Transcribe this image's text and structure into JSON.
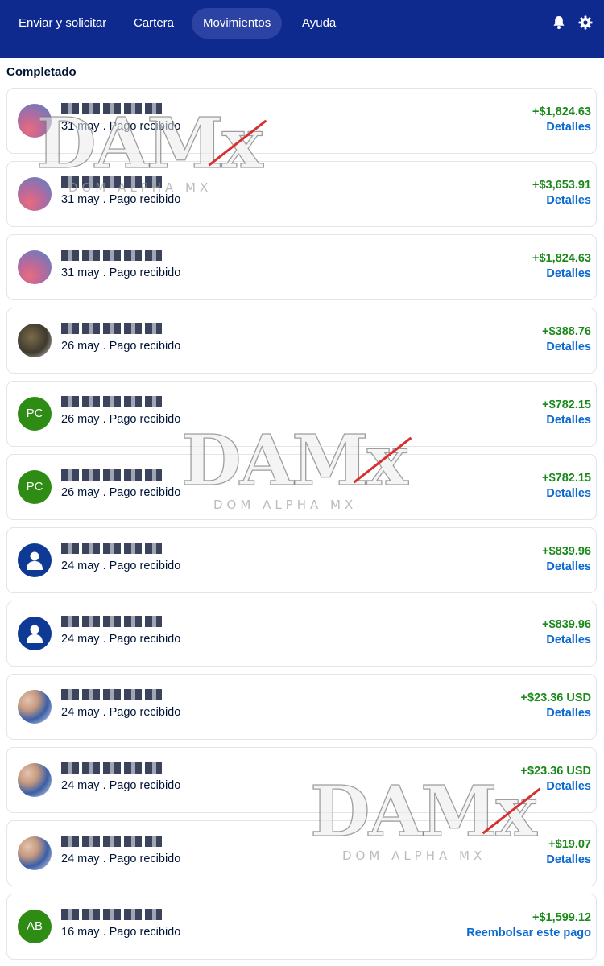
{
  "nav": {
    "tabs": [
      "Enviar y solicitar",
      "Cartera",
      "Movimientos",
      "Ayuda"
    ],
    "active_tab": "Movimientos",
    "icons": [
      "bell-icon",
      "gear-icon"
    ]
  },
  "section_title": "Completado",
  "transactions": [
    {
      "avatar": "gradient",
      "meta": "31 may . Pago recibido",
      "amount": "+$1,824.63",
      "action": "Detalles"
    },
    {
      "avatar": "gradient",
      "meta": "31 may . Pago recibido",
      "amount": "+$3,653.91",
      "action": "Detalles"
    },
    {
      "avatar": "gradient",
      "meta": "31 may . Pago recibido",
      "amount": "+$1,824.63",
      "action": "Detalles"
    },
    {
      "avatar": "photo",
      "meta": "26 may . Pago recibido",
      "amount": "+$388.76",
      "action": "Detalles"
    },
    {
      "avatar": "initials",
      "initials": "PC",
      "meta": "26 may . Pago recibido",
      "amount": "+$782.15",
      "action": "Detalles"
    },
    {
      "avatar": "initials",
      "initials": "PC",
      "meta": "26 may . Pago recibido",
      "amount": "+$782.15",
      "action": "Detalles"
    },
    {
      "avatar": "user",
      "meta": "24 may . Pago recibido",
      "amount": "+$839.96",
      "action": "Detalles"
    },
    {
      "avatar": "user",
      "meta": "24 may . Pago recibido",
      "amount": "+$839.96",
      "action": "Detalles"
    },
    {
      "avatar": "photo2",
      "meta": "24 may . Pago recibido",
      "amount": "+$23.36 USD",
      "action": "Detalles"
    },
    {
      "avatar": "photo2",
      "meta": "24 may . Pago recibido",
      "amount": "+$23.36 USD",
      "action": "Detalles"
    },
    {
      "avatar": "photo2",
      "meta": "24 may . Pago recibido",
      "amount": "+$19.07",
      "action": "Detalles"
    },
    {
      "avatar": "initials",
      "initials": "AB",
      "meta": "16 may . Pago recibido",
      "amount": "+$1,599.12",
      "action": "Reembolsar este pago"
    }
  ],
  "watermark": {
    "logo": "DAMx",
    "tagline": "DOM ALPHA MX"
  },
  "colors": {
    "nav_bg": "#0e2a8f",
    "amount": "#1a8a1a",
    "link": "#0d6ad1",
    "text": "#001435"
  }
}
